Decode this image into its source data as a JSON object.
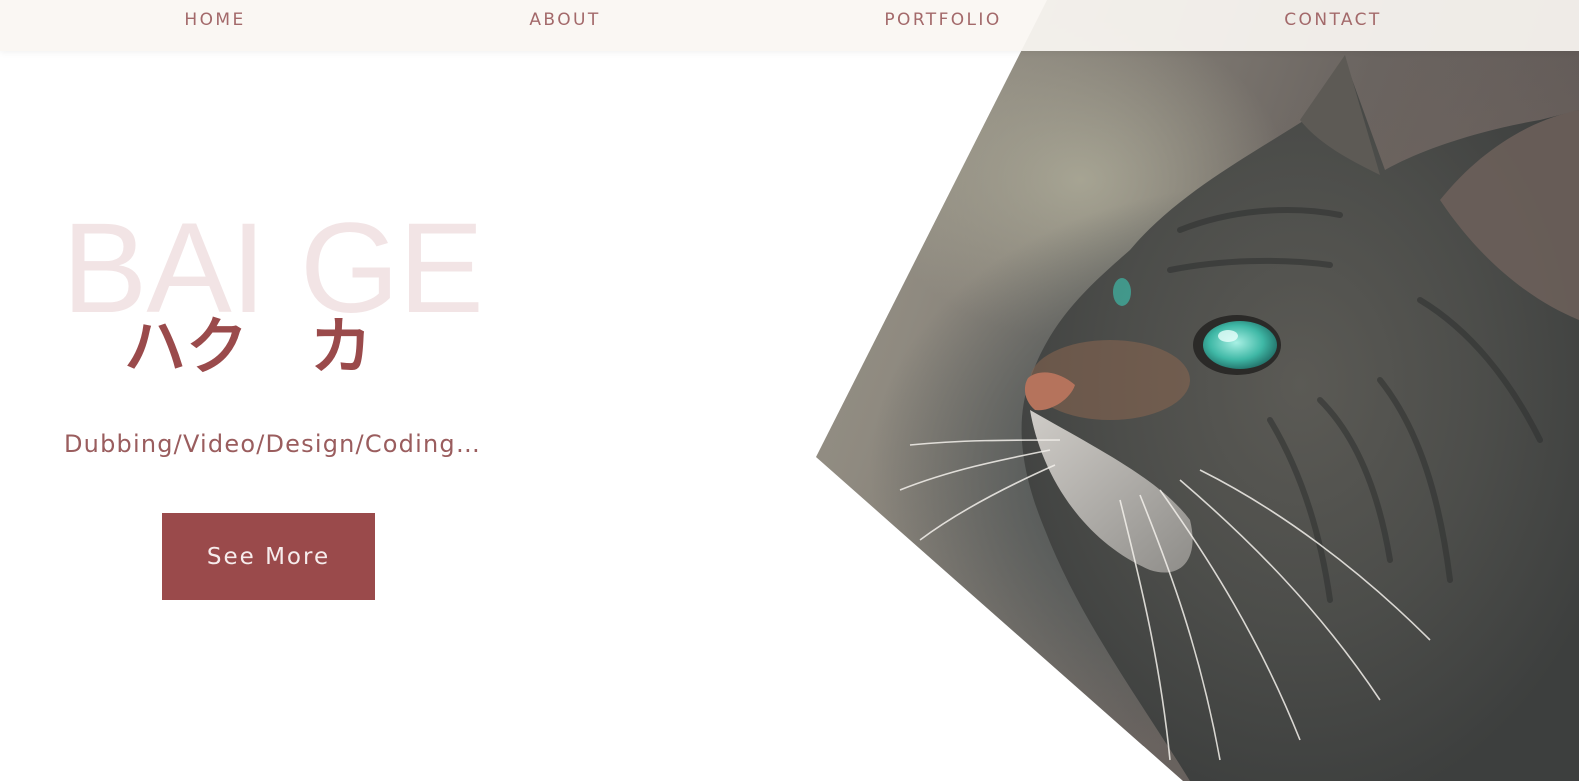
{
  "nav": {
    "items": [
      {
        "label": "HOME"
      },
      {
        "label": "ABOUT"
      },
      {
        "label": "PORTFOLIO"
      },
      {
        "label": "CONTACT"
      }
    ]
  },
  "hero": {
    "background_name": "BAI GE",
    "japanese_name": "ハク　カ",
    "tagline": "Dubbing/Video/Design/Coding…",
    "cta_label": "See More",
    "image_subject": "tabby cat looking up"
  },
  "colors": {
    "accent": "#9a4a4b",
    "nav_text": "#a3696a",
    "name_watermark": "#f2e4e5",
    "nav_background": "#faf6f2"
  }
}
